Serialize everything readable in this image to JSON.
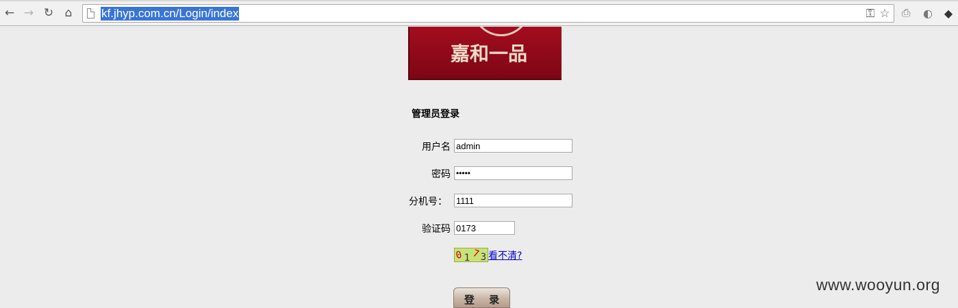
{
  "browser": {
    "url": "kf.jhyp.com.cn/Login/index",
    "icons": [
      "back-icon",
      "forward-icon",
      "reload-icon",
      "home-icon",
      "page-icon",
      "key-icon",
      "star-icon",
      "print-icon",
      "globe-icon",
      "menu-icon"
    ]
  },
  "banner": {
    "logo_text": "嘉和一品"
  },
  "form": {
    "title": "管理员登录",
    "username_label": "用户名",
    "username_value": "admin",
    "password_label": "密码",
    "password_value": "•••••",
    "extension_label": "分机号：",
    "extension_value": "1111",
    "captcha_label": "验证码",
    "captcha_value": "0173",
    "captcha_chars": [
      "0",
      "1",
      "7",
      "3"
    ],
    "refresh_link": "看不清?",
    "login_button": "登 录"
  },
  "watermark": "www.wooyun.org",
  "colors": {
    "url_highlight": "#3875d7",
    "banner_red": "#a30d1f",
    "link_blue": "#0000cc"
  }
}
